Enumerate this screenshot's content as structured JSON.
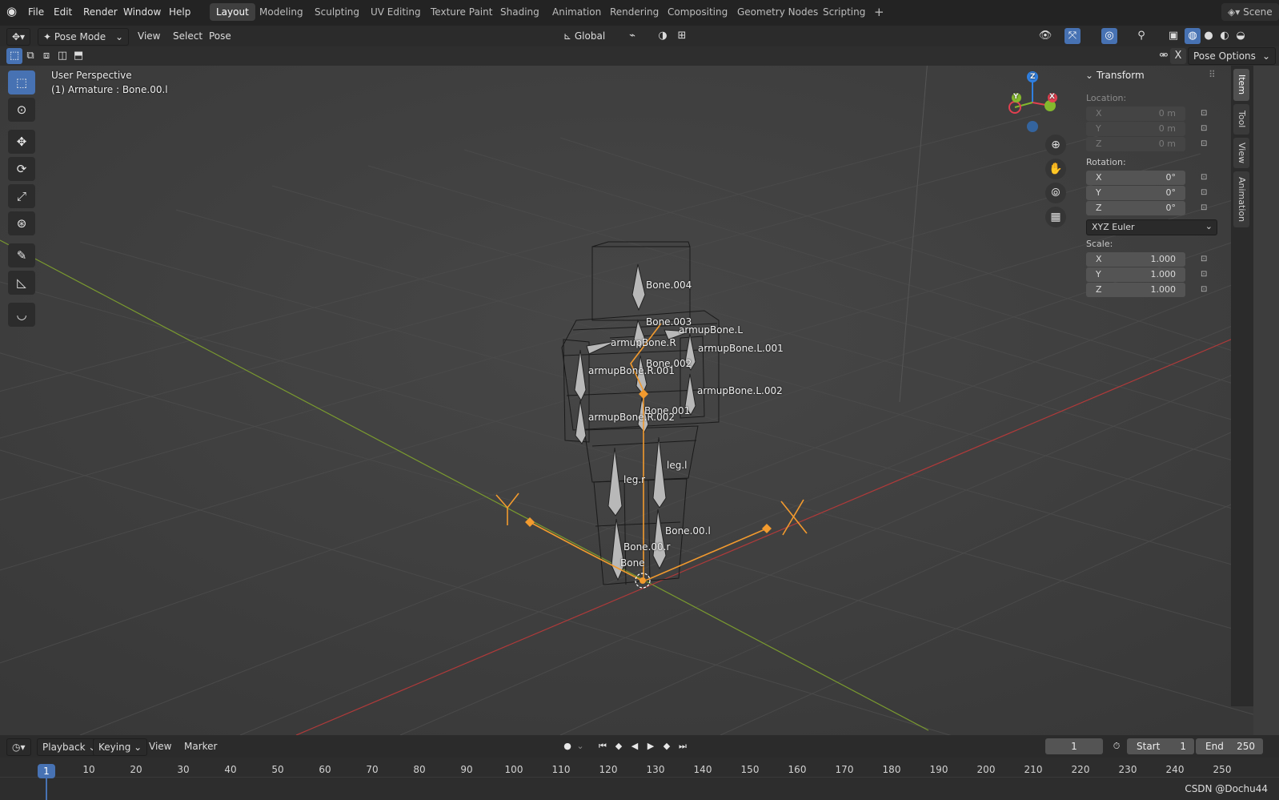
{
  "menubar": {
    "menus": [
      "File",
      "Edit",
      "Render",
      "Window",
      "Help"
    ],
    "workspaces": [
      "Layout",
      "Modeling",
      "Sculpting",
      "UV Editing",
      "Texture Paint",
      "Shading",
      "Animation",
      "Rendering",
      "Compositing",
      "Geometry Nodes",
      "Scripting"
    ],
    "active_workspace": "Layout",
    "add_tab": "+",
    "scene": "Scene"
  },
  "header": {
    "mode": "Pose Mode",
    "menus": [
      "View",
      "Select",
      "Pose"
    ],
    "orientation": "Global",
    "pose_options": "Pose Options",
    "x_mirror": "X"
  },
  "viewport": {
    "perspective": "User Perspective",
    "active": "(1) Armature : Bone.00.l",
    "bone_labels": [
      "Bone.004",
      "Bone.003",
      "armupBone.L",
      "armupBone.R",
      "armupBone.L.001",
      "Bone.002",
      "armupBone.R.001",
      "armupBone.L.002",
      "Bone.001",
      "armupBone.R.002",
      "leg.l",
      "leg.r",
      "Bone.00.l",
      "Bone.00.r",
      "Bone"
    ],
    "empty_labels": [
      "Y",
      "X"
    ],
    "gizmo_axes": [
      "Z",
      "Y",
      "X"
    ]
  },
  "npanel": {
    "title": "Transform",
    "location_label": "Location:",
    "location": [
      [
        "X",
        "0 m"
      ],
      [
        "Y",
        "0 m"
      ],
      [
        "Z",
        "0 m"
      ]
    ],
    "rotation_label": "Rotation:",
    "rotation": [
      [
        "X",
        "0°"
      ],
      [
        "Y",
        "0°"
      ],
      [
        "Z",
        "0°"
      ]
    ],
    "rotation_mode": "XYZ Euler",
    "scale_label": "Scale:",
    "scale": [
      [
        "X",
        "1.000"
      ],
      [
        "Y",
        "1.000"
      ],
      [
        "Z",
        "1.000"
      ]
    ],
    "tabs": [
      "Item",
      "Tool",
      "View",
      "Animation"
    ]
  },
  "timeline": {
    "menus": [
      "Playback",
      "Keying",
      "View",
      "Marker"
    ],
    "current_frame": "1",
    "start_label": "Start",
    "start": "1",
    "end_label": "End",
    "end": "250",
    "ruler": [
      "10",
      "20",
      "30",
      "40",
      "50",
      "60",
      "70",
      "80",
      "90",
      "100",
      "110",
      "120",
      "130",
      "140",
      "150",
      "160",
      "170",
      "180",
      "190",
      "200",
      "210",
      "220",
      "230",
      "240",
      "250"
    ],
    "playhead": "1"
  },
  "watermark": "CSDN @Dochu44",
  "colors": {
    "accent": "#4772b3",
    "selected_bone": "#f29a2e",
    "x_axis": "#b03a3a",
    "y_axis": "#7a9a2f",
    "gizmo_x": "#e24050",
    "gizmo_y": "#84b82d",
    "gizmo_z": "#2f7fe0"
  }
}
